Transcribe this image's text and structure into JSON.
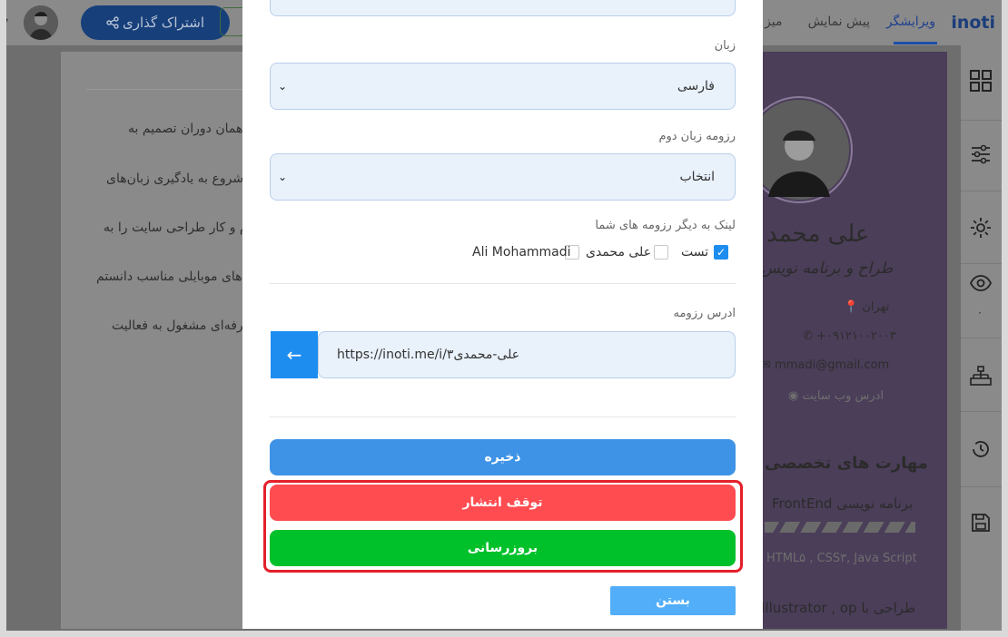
{
  "app": {
    "logo": "inoti",
    "tabs": [
      {
        "label": "ویرایشگر",
        "active": true
      },
      {
        "label": "پیش نمایش",
        "active": false
      },
      {
        "label": "میز",
        "active": false
      }
    ],
    "share_label": "اشتراک گذاری",
    "user_caret": "▾"
  },
  "resume_bio": {
    "lines": [
      "از همان دوران تصمیم به",
      "ل شروع به یادگیری زبان‌های",
      "شدم و کار طراحی سایت را به",
      "ن های موبایلی مناسب دانستم",
      "؛ حرفه‌ای مشغول به فعالیت"
    ]
  },
  "profile_card": {
    "name": "علی محمد",
    "title": "طراح و برنامه نویس",
    "city": "تهران",
    "phone": "۰۹۱۲۱۰۰۲۰۰۳+",
    "email": "mmadi@gmail.com",
    "website": "ادرس وب سایت",
    "skills_heading": "مهارت های تخصصی",
    "skill_1": "برنامه نویسی FrontEnd",
    "skill_1_detail": "HTML۵ , CSS۳, Java Script",
    "skill_2": "طراحی با Illustrator , op"
  },
  "sidebar": {
    "views_count": "۰",
    "icons": [
      "grid-icon",
      "sliders-icon",
      "settings-icon",
      "eye-icon",
      "org-chart-icon",
      "history-icon",
      "save-icon"
    ]
  },
  "modal": {
    "language_label": "زبان",
    "language_value": "فارسی",
    "second_lang_label": "رزومه زبان دوم",
    "second_lang_value": "انتخاب",
    "links_label": "لینک به دیگر رزومه های شما",
    "links": [
      {
        "label": "تست",
        "checked": true
      },
      {
        "label": "علی محمدی",
        "checked": false
      },
      {
        "label": "Ali Mohammadi",
        "checked": false
      }
    ],
    "url_label": "ادرس رزومه",
    "url_prefix": "https://inoti.me/i/۳",
    "url_slug": "علی-محمدی",
    "save_label": "ذخیره",
    "pause_label": "توقف انتشار",
    "update_label": "بروزرسانی",
    "close_label": "بستن"
  },
  "colors": {
    "primary": "#1d8df0",
    "save": "#3e93e6",
    "danger": "#ff4c50",
    "success": "#00c12a",
    "highlight": "#e4202a",
    "card_purple": "#4b3e59"
  }
}
